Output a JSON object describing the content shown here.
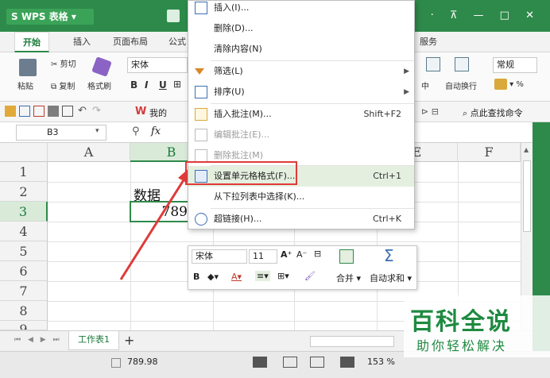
{
  "app": {
    "logo_text": "S WPS 表格",
    "help_text": "? ·"
  },
  "ribbon_tabs": [
    "开始",
    "插入",
    "页面布局",
    "公式",
    "服务"
  ],
  "ribbon": {
    "cut_label": "剪切",
    "paste_label": "粘贴",
    "copy_label": "复制",
    "format_painter_label": "格式刷",
    "font_name": "宋体",
    "merge_center_label": "中",
    "wrap_text_label": "自动换行",
    "number_format_value": "常规",
    "percent_label": "%"
  },
  "quickbar": {
    "my_label": "我的",
    "search_label": "点此查找命令"
  },
  "formula_bar": {
    "cell_ref": "B3",
    "fx_label": "fx"
  },
  "grid": {
    "columns": [
      "A",
      "B",
      "E",
      "F"
    ],
    "rows": [
      "1",
      "2",
      "3",
      "4",
      "5",
      "6",
      "7",
      "8",
      "9"
    ],
    "cells": {
      "B2": "数据",
      "B3": "789.98"
    }
  },
  "context_menu": {
    "items": [
      {
        "label": "插入(I)...",
        "shortcut": "",
        "icon": "insert-icon"
      },
      {
        "label": "删除(D)...",
        "shortcut": "",
        "icon": ""
      },
      {
        "label": "清除内容(N)",
        "shortcut": "",
        "icon": ""
      },
      {
        "label": "筛选(L)",
        "shortcut": "",
        "icon": "filter-icon",
        "submenu": true
      },
      {
        "label": "排序(U)",
        "shortcut": "",
        "icon": "sort-icon",
        "submenu": true
      },
      {
        "label": "插入批注(M)...",
        "shortcut": "Shift+F2",
        "icon": "comment-icon"
      },
      {
        "label": "编辑批注(E)...",
        "shortcut": "",
        "icon": "edit-comment-icon",
        "disabled": true
      },
      {
        "label": "删除批注(M)",
        "shortcut": "",
        "icon": "delete-comment-icon",
        "disabled": true
      },
      {
        "label": "设置单元格格式(F)...",
        "shortcut": "Ctrl+1",
        "icon": "format-cells-icon",
        "highlighted": true
      },
      {
        "label": "从下拉列表中选择(K)...",
        "shortcut": "",
        "icon": ""
      },
      {
        "label": "超链接(H)...",
        "shortcut": "Ctrl+K",
        "icon": "hyperlink-icon"
      }
    ]
  },
  "mini_toolbar": {
    "font_name": "宋体",
    "font_size": "11",
    "merge_label": "合并",
    "autosum_label": "自动求和"
  },
  "sheet_tabs": [
    "工作表1"
  ],
  "status": {
    "value": "789.98",
    "zoom": "153 %"
  },
  "watermark": {
    "title": "百科全说",
    "subtitle": "助你轻松解决"
  },
  "colors": {
    "accent": "#2e8a4a",
    "highlight_box": "#e03a3a",
    "watermark": "#1e8a40"
  }
}
